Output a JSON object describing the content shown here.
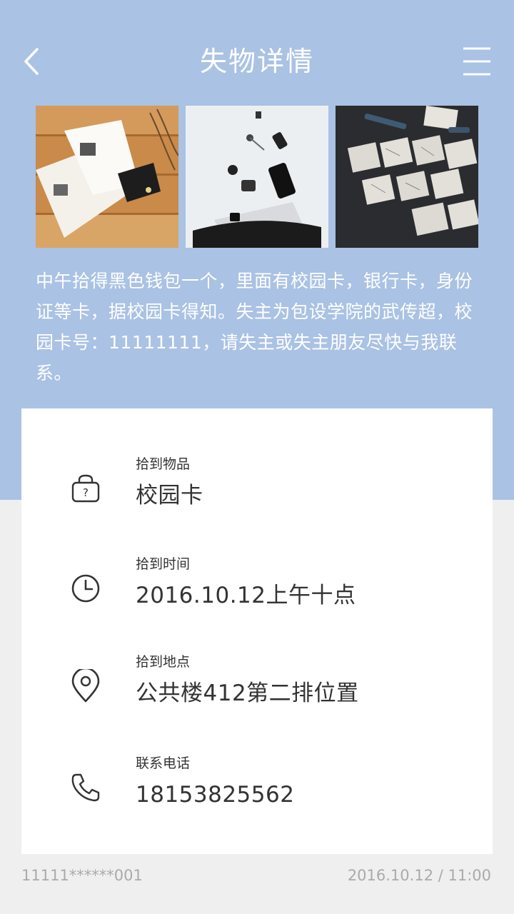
{
  "header": {
    "title": "失物详情",
    "back_icon": "chevron-left-icon",
    "menu_icon": "menu-icon"
  },
  "photos": [
    {
      "subject": "open booklet and black wallet on wooden table"
    },
    {
      "subject": "keys, phone, laptop and bag on white background"
    },
    {
      "subject": "sketch paper notes on dark desk"
    }
  ],
  "description": "中午拾得黑色钱包一个，里面有校园卡，银行卡，身份证等卡，据校园卡得知。失主为包设学院的武传超，校园卡号：11111111，请失主或失主朋友尽快与我联系。",
  "details": [
    {
      "icon": "lost-item-bag-icon",
      "label": "拾到物品",
      "value": "校园卡"
    },
    {
      "icon": "clock-icon",
      "label": "拾到时间",
      "value": "2016.10.12上午十点"
    },
    {
      "icon": "location-pin-icon",
      "label": "拾到地点",
      "value": "公共楼412第二排位置"
    },
    {
      "icon": "phone-icon",
      "label": "联系电话",
      "value": "18153825562"
    }
  ],
  "footer": {
    "poster_id": "11111******001",
    "datetime": "2016.10.12 / 11:00"
  },
  "colors": {
    "header_bg": "#aac2e3",
    "page_bg": "#efefef",
    "card_bg": "#ffffff",
    "text_dark": "#333333",
    "text_muted": "#aaaaaa"
  }
}
